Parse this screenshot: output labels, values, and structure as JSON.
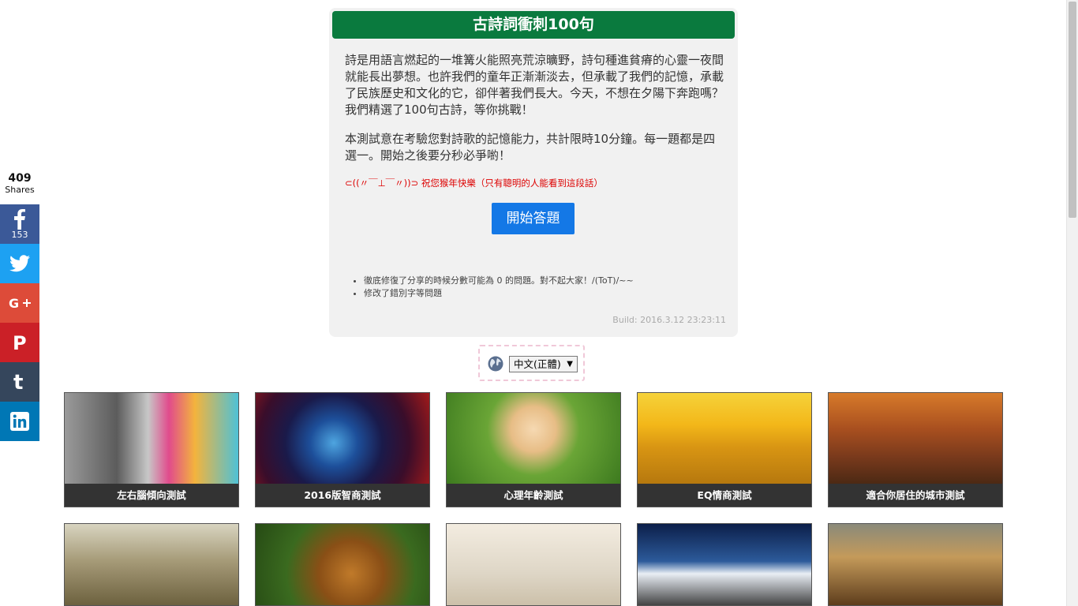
{
  "share": {
    "count": "409",
    "label": "Shares",
    "facebook_count": "153",
    "buttons": [
      "facebook-icon",
      "twitter-icon",
      "google-plus-icon",
      "pinterest-icon",
      "tumblr-icon",
      "linkedin-icon"
    ]
  },
  "card": {
    "title": "古詩詞衝刺100句",
    "intro": "詩是用語言燃起的一堆篝火能照亮荒涼曠野，詩句種進貧瘠的心靈一夜間就能長出夢想。也許我們的童年正漸漸淡去，但承載了我們的記憶，承載了民族歷史和文化的它，卻伴著我們長大。今天，不想在夕陽下奔跑嗎？我們精選了100句古詩，等你挑戰！",
    "rules": "本測試意在考驗您對詩歌的記憶能力，共計限時10分鐘。每一題都是四選一。開始之後要分秒必爭喲！",
    "easter_egg": "⊂((〃￣⊥￣〃))⊃ 祝您猴年快樂（只有聰明的人能看到這段話）",
    "start_label": "開始答題",
    "changelog": [
      "徹底修復了分享的時候分數可能為 0 的問題。對不起大家！/(ToT)/~~",
      "修改了錯別字等問題"
    ],
    "build": "Build: 2016.3.12 23:23:11"
  },
  "language": {
    "selected": "中文(正體)"
  },
  "tiles": [
    {
      "caption": "左右腦傾向測試"
    },
    {
      "caption": "2016版智商測試"
    },
    {
      "caption": "心理年齡測試"
    },
    {
      "caption": "EQ情商測試"
    },
    {
      "caption": "適合你居住的城市測試"
    }
  ],
  "colors": {
    "title_bg": "#0a7a3e",
    "start_button": "#1478e6",
    "easter_egg_text": "#dd0000"
  }
}
